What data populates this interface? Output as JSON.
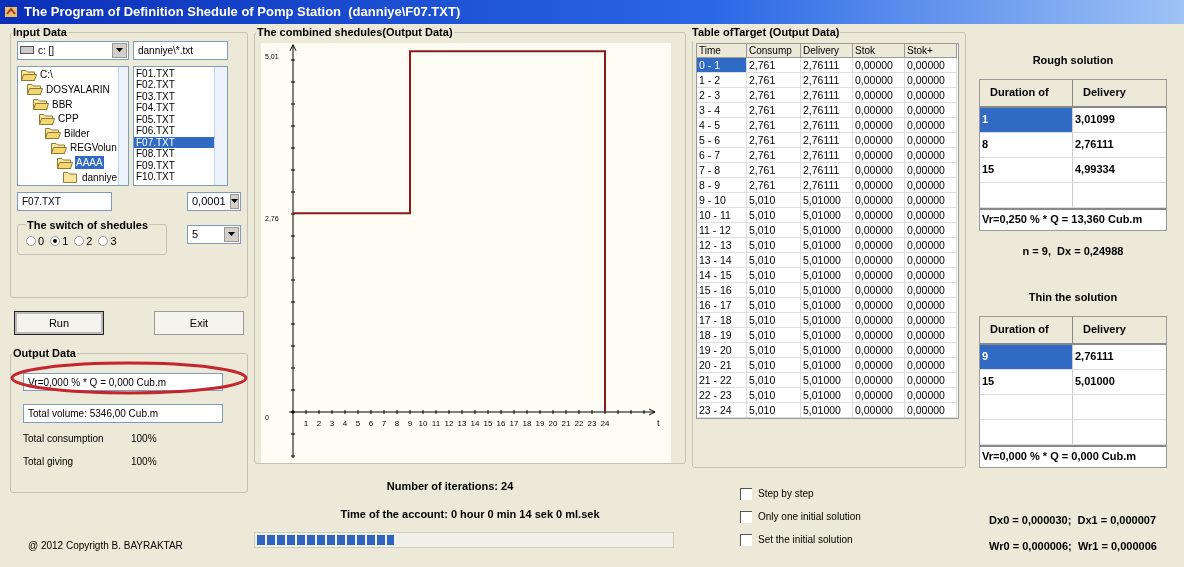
{
  "window": {
    "title": "The Program of Definition Shedule of Pomp Station  (danniye\\F07.TXT)"
  },
  "input_data": {
    "title": "Input Data",
    "drive": "c: []",
    "filter": "danniye\\*.txt",
    "folders": [
      {
        "label": "C:\\",
        "selected": false,
        "children": [
          {
            "label": "DOSYALARIN",
            "selected": false,
            "children": [
              {
                "label": "BBR",
                "selected": false,
                "children": [
                  {
                    "label": "CPP",
                    "selected": false,
                    "children": [
                      {
                        "label": "Bilder",
                        "selected": false,
                        "children": [
                          {
                            "label": "REGVolun",
                            "selected": false,
                            "children": [
                              {
                                "label": "AAAA",
                                "selected": true,
                                "children": [
                                  {
                                    "label": "danniye",
                                    "selected": false
                                  }
                                ]
                              }
                            ]
                          }
                        ]
                      }
                    ]
                  }
                ]
              }
            ]
          }
        ]
      }
    ],
    "files": [
      {
        "label": "F01.TXT",
        "selected": false
      },
      {
        "label": "F02.TXT",
        "selected": false
      },
      {
        "label": "F03.TXT",
        "selected": false
      },
      {
        "label": "F04.TXT",
        "selected": false
      },
      {
        "label": "F05.TXT",
        "selected": false
      },
      {
        "label": "F06.TXT",
        "selected": false
      },
      {
        "label": "F07.TXT",
        "selected": true
      },
      {
        "label": "F08.TXT",
        "selected": false
      },
      {
        "label": "F09.TXT",
        "selected": false
      },
      {
        "label": "F10.TXT",
        "selected": false
      }
    ],
    "file_name": "F07.TXT",
    "precision": "0,0001",
    "switch": {
      "title": "The switch of shedules",
      "options": [
        {
          "label": "0",
          "selected": false
        },
        {
          "label": "1",
          "selected": true
        },
        {
          "label": "2",
          "selected": false
        },
        {
          "label": "3",
          "selected": false
        }
      ]
    },
    "count": "5"
  },
  "buttons": [
    "Run",
    "Exit"
  ],
  "output_data": {
    "title": "Output Data",
    "vr": "Vr=0,000 % * Q = 0,000 Cub.m",
    "total_volume": "Total volume: 5346,00 Cub.m",
    "totals": [
      {
        "label": "Total consumption",
        "value": "100%"
      },
      {
        "label": "Total giving",
        "value": "100%"
      }
    ]
  },
  "copyright": "@ 2012 Copyrigth B. BAYRAKTAR",
  "chart": {
    "title": "The combined shedules(Output Data)",
    "chart_data": {
      "type": "line",
      "annotations": [
        "t"
      ],
      "xlim": [
        -0.3,
        27.85
      ],
      "ylim": [
        -0.64,
        5.1
      ],
      "x": [
        0,
        9,
        9,
        24,
        24
      ],
      "series": [
        {
          "color": "#8b1a1a",
          "values": [
            2.76,
            2.76,
            5.01,
            5.01,
            0
          ]
        }
      ],
      "xticks": [
        1,
        2,
        3,
        4,
        5,
        6,
        7,
        8,
        9,
        10,
        11,
        12,
        13,
        14,
        15,
        16,
        17,
        18,
        19,
        20,
        21,
        22,
        23,
        24
      ],
      "yticks": [
        {
          "value": 0,
          "label": "0"
        },
        {
          "value": 2.76,
          "label": "2,76"
        },
        {
          "value": 5.01,
          "label": "5,01"
        }
      ]
    }
  },
  "iterations": "Number of iterations: 24",
  "time": "Time of the account: 0 hour 0 min 14 sek 0 ml.sek",
  "progress": {
    "level": 0.33
  },
  "table": {
    "title": "Table ofTarget (Output Data)",
    "columns": [
      "Time",
      "Consump",
      "Delivery",
      "Stok",
      "Stok+"
    ],
    "rows": [
      {
        "cells": [
          "0 - 1",
          "2,761",
          "2,76111",
          "0,00000",
          "0,00000"
        ],
        "selected": true
      },
      {
        "cells": [
          "1 - 2",
          "2,761",
          "2,76111",
          "0,00000",
          "0,00000"
        ],
        "selected": false
      },
      {
        "cells": [
          "2 - 3",
          "2,761",
          "2,76111",
          "0,00000",
          "0,00000"
        ],
        "selected": false
      },
      {
        "cells": [
          "3 - 4",
          "2,761",
          "2,76111",
          "0,00000",
          "0,00000"
        ],
        "selected": false
      },
      {
        "cells": [
          "4 - 5",
          "2,761",
          "2,76111",
          "0,00000",
          "0,00000"
        ],
        "selected": false
      },
      {
        "cells": [
          "5 - 6",
          "2,761",
          "2,76111",
          "0,00000",
          "0,00000"
        ],
        "selected": false
      },
      {
        "cells": [
          "6 - 7",
          "2,761",
          "2,76111",
          "0,00000",
          "0,00000"
        ],
        "selected": false
      },
      {
        "cells": [
          "7 - 8",
          "2,761",
          "2,76111",
          "0,00000",
          "0,00000"
        ],
        "selected": false
      },
      {
        "cells": [
          "8 - 9",
          "2,761",
          "2,76111",
          "0,00000",
          "0,00000"
        ],
        "selected": false
      },
      {
        "cells": [
          "9 - 10",
          "5,010",
          "5,01000",
          "0,00000",
          "0,00000"
        ],
        "selected": false
      },
      {
        "cells": [
          "10 - 11",
          "5,010",
          "5,01000",
          "0,00000",
          "0,00000"
        ],
        "selected": false
      },
      {
        "cells": [
          "11 - 12",
          "5,010",
          "5,01000",
          "0,00000",
          "0,00000"
        ],
        "selected": false
      },
      {
        "cells": [
          "12 - 13",
          "5,010",
          "5,01000",
          "0,00000",
          "0,00000"
        ],
        "selected": false
      },
      {
        "cells": [
          "13 - 14",
          "5,010",
          "5,01000",
          "0,00000",
          "0,00000"
        ],
        "selected": false
      },
      {
        "cells": [
          "14 - 15",
          "5,010",
          "5,01000",
          "0,00000",
          "0,00000"
        ],
        "selected": false
      },
      {
        "cells": [
          "15 - 16",
          "5,010",
          "5,01000",
          "0,00000",
          "0,00000"
        ],
        "selected": false
      },
      {
        "cells": [
          "16 - 17",
          "5,010",
          "5,01000",
          "0,00000",
          "0,00000"
        ],
        "selected": false
      },
      {
        "cells": [
          "17 - 18",
          "5,010",
          "5,01000",
          "0,00000",
          "0,00000"
        ],
        "selected": false
      },
      {
        "cells": [
          "18 - 19",
          "5,010",
          "5,01000",
          "0,00000",
          "0,00000"
        ],
        "selected": false
      },
      {
        "cells": [
          "19 - 20",
          "5,010",
          "5,01000",
          "0,00000",
          "0,00000"
        ],
        "selected": false
      },
      {
        "cells": [
          "20 - 21",
          "5,010",
          "5,01000",
          "0,00000",
          "0,00000"
        ],
        "selected": false
      },
      {
        "cells": [
          "21 - 22",
          "5,010",
          "5,01000",
          "0,00000",
          "0,00000"
        ],
        "selected": false
      },
      {
        "cells": [
          "22 - 23",
          "5,010",
          "5,01000",
          "0,00000",
          "0,00000"
        ],
        "selected": false
      },
      {
        "cells": [
          "23 - 24",
          "5,010",
          "5,01000",
          "0,00000",
          "0,00000"
        ],
        "selected": false
      }
    ]
  },
  "options": [
    {
      "label": "Step by step",
      "checked": false
    },
    {
      "label": "Only one initial solution",
      "checked": false
    },
    {
      "label": "Set the  initial solution",
      "checked": false
    }
  ],
  "rough_solution": {
    "title": "Rough solution",
    "columns": [
      "Duration of",
      "Delivery"
    ],
    "rows": [
      {
        "cells": [
          "1",
          "3,01099"
        ],
        "selected": true
      },
      {
        "cells": [
          "8",
          "2,76111"
        ],
        "selected": false
      },
      {
        "cells": [
          "15",
          "4,99334"
        ],
        "selected": false
      }
    ],
    "summary": "Vr=0,250 % * Q = 13,360 Cub.m"
  },
  "stats": "n = 9,  Dx = 0,24988",
  "thin_solution": {
    "title": "Thin the solution",
    "columns": [
      "Duration of",
      "Delivery"
    ],
    "rows": [
      {
        "cells": [
          "9",
          "2,76111"
        ],
        "selected": true
      },
      {
        "cells": [
          "15",
          "5,01000"
        ],
        "selected": false
      }
    ],
    "summary": "Vr=0,000 % * Q = 0,000 Cub.m"
  },
  "errors": [
    "Dx0 = 0,000030;  Dx1 = 0,000007",
    "Wr0 = 0,000006;  Wr1 = 0,000006"
  ]
}
